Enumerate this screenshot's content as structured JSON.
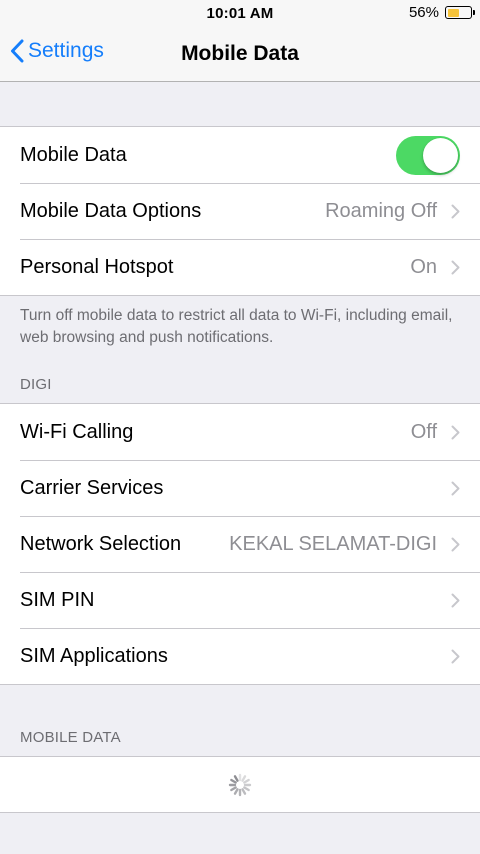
{
  "status_bar": {
    "time": "10:01 AM",
    "battery_percent": "56%",
    "battery_level": 0.56,
    "battery_color": "#f6c33a"
  },
  "nav": {
    "back_label": "Settings",
    "title": "Mobile Data",
    "accent_color": "#157efb"
  },
  "mobile_group": {
    "mobile_data": {
      "label": "Mobile Data",
      "toggle_on": true,
      "toggle_color": "#4cd964"
    },
    "options": {
      "label": "Mobile Data Options",
      "value": "Roaming Off"
    },
    "hotspot": {
      "label": "Personal Hotspot",
      "value": "On"
    }
  },
  "mobile_footer": "Turn off mobile data to restrict all data to Wi-Fi, including email, web browsing and push notifications.",
  "digi_section": {
    "header": "DIGI",
    "wifi_calling": {
      "label": "Wi-Fi Calling",
      "value": "Off"
    },
    "carrier_services": {
      "label": "Carrier Services"
    },
    "network_selection": {
      "label": "Network Selection",
      "value": "KEKAL SELAMAT-DIGI"
    },
    "sim_pin": {
      "label": "SIM PIN"
    },
    "sim_applications": {
      "label": "SIM Applications"
    }
  },
  "usage_section": {
    "header": "MOBILE DATA",
    "loading_icon": "activity-spinner-icon"
  }
}
